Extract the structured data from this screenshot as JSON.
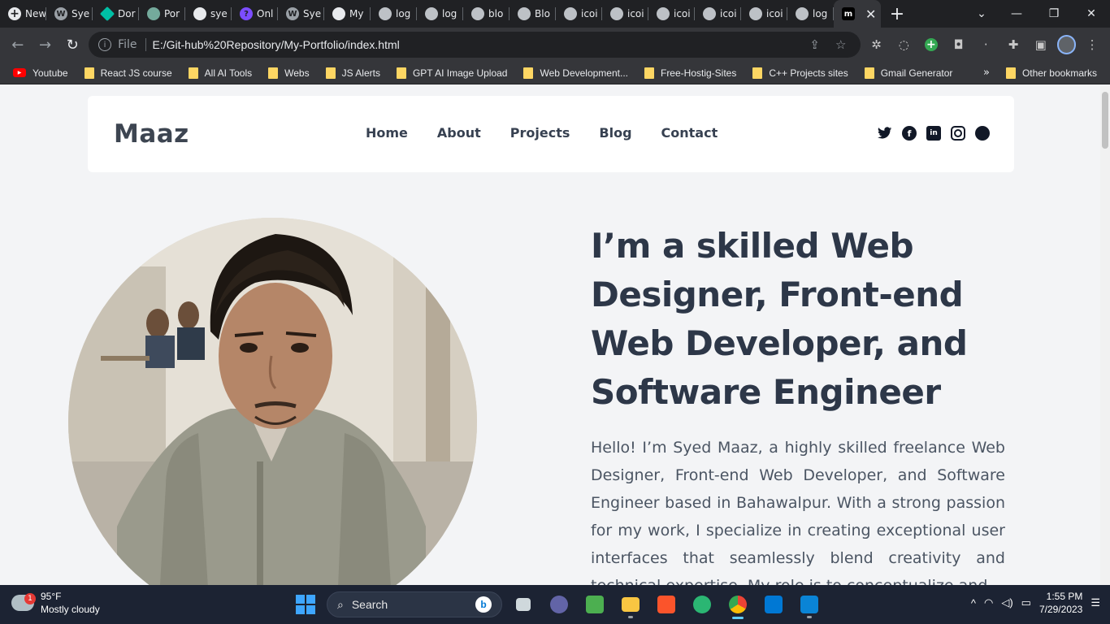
{
  "browser": {
    "tabs": [
      {
        "label": "New",
        "icon": "new-tab-icon"
      },
      {
        "label": "Sye",
        "icon": "wordpress-icon"
      },
      {
        "label": "Dor",
        "icon": "diamond-icon"
      },
      {
        "label": "Por",
        "icon": "chatgpt-icon"
      },
      {
        "label": "sye",
        "icon": "github-icon"
      },
      {
        "label": "Onl",
        "icon": "question-icon"
      },
      {
        "label": "Sye",
        "icon": "wordpress-icon"
      },
      {
        "label": "My",
        "icon": "github-icon"
      },
      {
        "label": "log",
        "icon": "globe-icon"
      },
      {
        "label": "log",
        "icon": "globe-icon"
      },
      {
        "label": "blo",
        "icon": "globe-icon"
      },
      {
        "label": "Blo",
        "icon": "globe-icon"
      },
      {
        "label": "icoi",
        "icon": "globe-icon"
      },
      {
        "label": "icoi",
        "icon": "globe-icon"
      },
      {
        "label": "icoi",
        "icon": "globe-icon"
      },
      {
        "label": "icoi",
        "icon": "globe-icon"
      },
      {
        "label": "icoi",
        "icon": "globe-icon"
      },
      {
        "label": "log",
        "icon": "globe-icon"
      }
    ],
    "active_tab_icon_text": "m",
    "close_symbol": "✕",
    "new_tab_symbol": "+",
    "url_scheme": "File",
    "url": "E:/Git-hub%20Repository/My-Portfolio/index.html",
    "bookmarks": [
      {
        "label": "Youtube",
        "type": "youtube"
      },
      {
        "label": "React JS course",
        "type": "folder"
      },
      {
        "label": "All AI Tools",
        "type": "folder"
      },
      {
        "label": "Webs",
        "type": "folder"
      },
      {
        "label": "JS Alerts",
        "type": "folder"
      },
      {
        "label": "GPT AI Image Upload",
        "type": "folder"
      },
      {
        "label": "Web Development...",
        "type": "folder"
      },
      {
        "label": "Free-Hostig-Sites",
        "type": "folder"
      },
      {
        "label": "C++ Projects sites",
        "type": "folder"
      },
      {
        "label": "Gmail Generator",
        "type": "folder"
      }
    ],
    "bookmarks_more": "»",
    "other_bookmarks": "Other bookmarks"
  },
  "site": {
    "logo": "Maaz",
    "menu": [
      "Home",
      "About",
      "Projects",
      "Blog",
      "Contact"
    ],
    "socials": [
      "twitter-icon",
      "facebook-icon",
      "linkedin-icon",
      "instagram-icon",
      "github-icon"
    ],
    "hero_title": "I’m a skilled Web Designer, Front-end Web Developer, and Software Engineer",
    "hero_text": "Hello! I’m Syed Maaz, a highly skilled freelance Web Designer, Front-end Web Developer, and Software Engineer based in Bahawalpur. With a strong passion for my work, I specialize in creating exceptional user interfaces that seamlessly blend creativity and technical expertise. My role is to conceptualize and"
  },
  "taskbar": {
    "weather_temp": "95°F",
    "weather_desc": "Mostly cloudy",
    "weather_badge": "1",
    "search_placeholder": "Search",
    "time": "1:55 PM",
    "date": "7/29/2023"
  },
  "colors": {
    "chrome_dark": "#202124",
    "toolbar": "#35363a",
    "page_bg": "#f3f4f6",
    "heading": "#2d3748",
    "taskbar": "#1c2333"
  }
}
